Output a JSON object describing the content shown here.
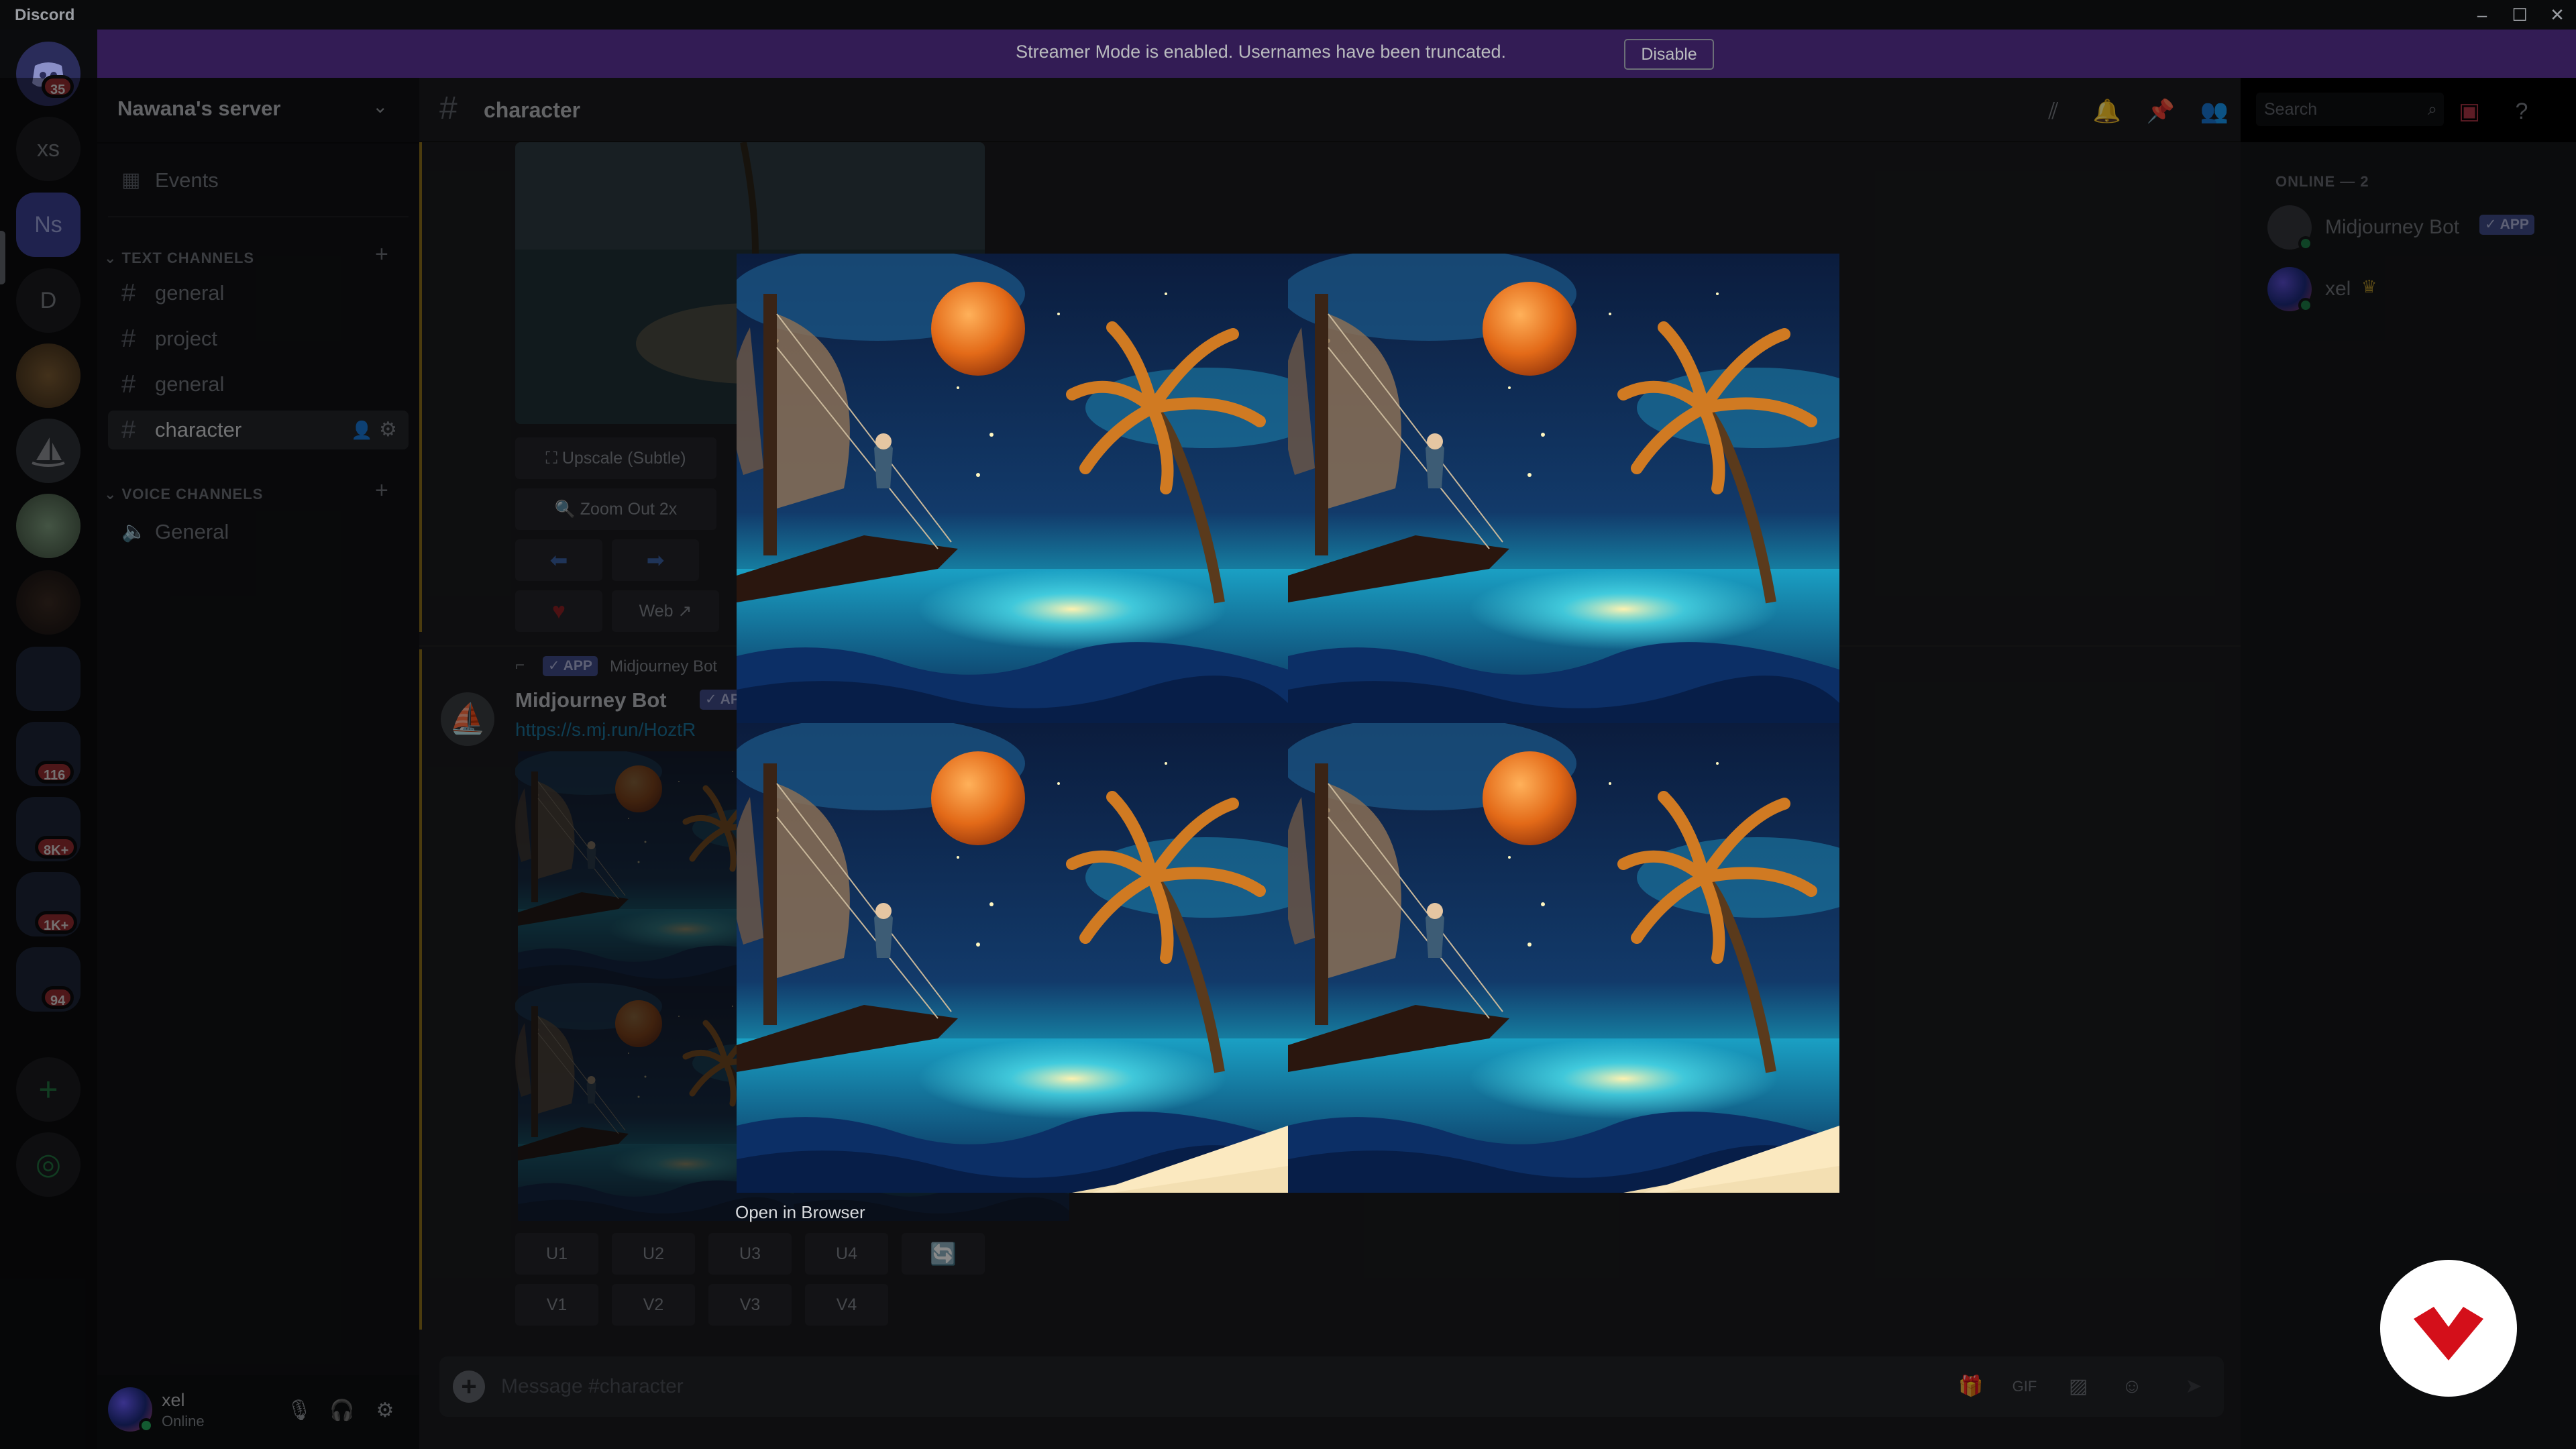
{
  "window": {
    "app_name": "Discord",
    "controls": [
      "minimize",
      "maximize",
      "close"
    ]
  },
  "banner": {
    "message": "Streamer Mode is enabled. Usernames have been truncated.",
    "disable_label": "Disable"
  },
  "servers": {
    "home_badge": "35",
    "items": [
      {
        "label": "xs"
      },
      {
        "label": "Ns",
        "active": true
      },
      {
        "label": "D"
      }
    ],
    "badges": [
      "116",
      "8K+",
      "1K+",
      "94"
    ]
  },
  "sidebar": {
    "server_name": "Nawana's server",
    "events_label": "Events",
    "text_category": "TEXT CHANNELS",
    "text_channels": [
      "general",
      "project",
      "general",
      "character"
    ],
    "voice_category": "VOICE CHANNELS",
    "voice_channels": [
      "General"
    ]
  },
  "user": {
    "name": "xel",
    "status": "Online"
  },
  "header": {
    "channel_name": "character",
    "search_placeholder": "Search"
  },
  "messages": {
    "first": {
      "buttons_row1": [
        "Upscale (Subtle)"
      ],
      "buttons_row2": [
        "Zoom Out 2x"
      ],
      "web_label": "Web"
    },
    "second": {
      "reply_badge": "✓ APP",
      "reply_name": "Midjourney Bot",
      "author": "Midjourney Bot",
      "author_badge": "✓ APP",
      "link": "https://s.mj.run/HoztR",
      "upscale_buttons": [
        "U1",
        "U2",
        "U3",
        "U4"
      ],
      "variation_buttons": [
        "V1",
        "V2",
        "V3",
        "V4"
      ]
    }
  },
  "composer": {
    "placeholder": "Message #character"
  },
  "members": {
    "header": "ONLINE — 2",
    "list": [
      {
        "name": "Midjourney Bot",
        "badge": "✓ APP"
      },
      {
        "name": "xel",
        "crown": true
      }
    ]
  },
  "lightbox": {
    "open_in_browser": "Open in Browser"
  },
  "colors": {
    "accent": "#5865f2",
    "online": "#23a559",
    "banner": "#331c55"
  }
}
